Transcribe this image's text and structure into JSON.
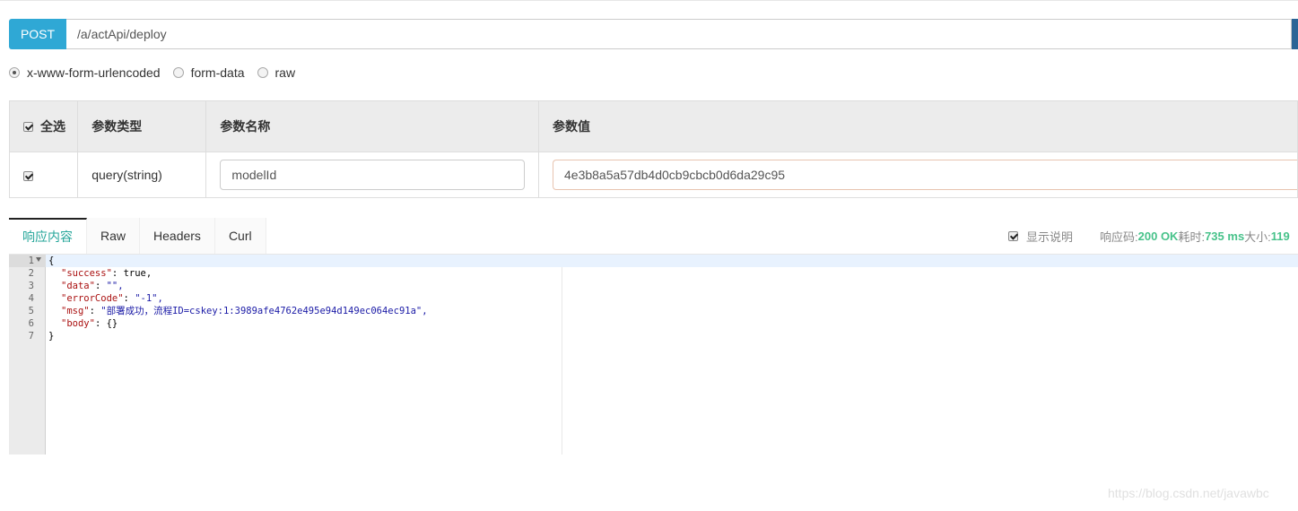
{
  "request": {
    "method": "POST",
    "url": "/a/actApi/deploy"
  },
  "body_types": [
    {
      "label": "x-www-form-urlencoded",
      "selected": true
    },
    {
      "label": "form-data",
      "selected": false
    },
    {
      "label": "raw",
      "selected": false
    }
  ],
  "params_table": {
    "headers": {
      "select_all": "全选",
      "type": "参数类型",
      "name": "参数名称",
      "value": "参数值"
    },
    "rows": [
      {
        "checked": true,
        "type": "query(string)",
        "name": "modelId",
        "value": "4e3b8a5a57db4d0cb9cbcb0d6da29c95"
      }
    ]
  },
  "response": {
    "tabs": [
      "响应内容",
      "Raw",
      "Headers",
      "Curl"
    ],
    "active_tab": "响应内容",
    "show_description_label": "显示说明",
    "status_label": "响应码:",
    "status_value": "200 OK",
    "time_label": "耗时:",
    "time_value": "735 ms",
    "size_label": "大小:",
    "size_value": "119"
  },
  "code": {
    "line_numbers": [
      "1",
      "2",
      "3",
      "4",
      "5",
      "6",
      "7"
    ],
    "lines": [
      {
        "key": "",
        "value": "{"
      },
      {
        "key": "\"success\"",
        "sep": ": ",
        "value": "true,"
      },
      {
        "key": "\"data\"",
        "sep": ": ",
        "value": "\"\","
      },
      {
        "key": "\"errorCode\"",
        "sep": ": ",
        "value": "\"-1\","
      },
      {
        "key": "\"msg\"",
        "sep": ": ",
        "value": "\"部署成功，流程ID=cskey:1:3989afe4762e495e94d149ec064ec91a\","
      },
      {
        "key": "\"body\"",
        "sep": ": ",
        "value": "{}"
      },
      {
        "key": "",
        "value": "}"
      }
    ]
  },
  "watermark": "https://blog.csdn.net/javawbc",
  "colors": {
    "method_button": "#2fa8d5",
    "accent_green": "#47c28a",
    "tab_active_text": "#26a69a"
  }
}
